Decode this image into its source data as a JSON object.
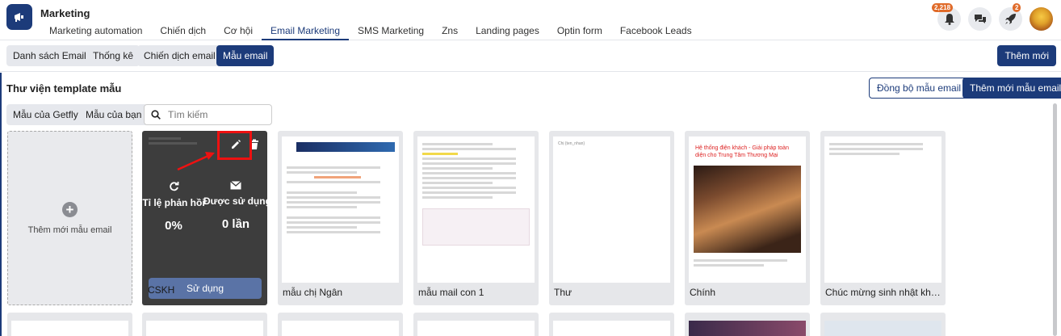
{
  "app": {
    "title": "Marketing"
  },
  "nav": {
    "items": [
      {
        "label": "Marketing automation",
        "active": false
      },
      {
        "label": "Chiến dịch",
        "active": false
      },
      {
        "label": "Cơ hội",
        "active": false
      },
      {
        "label": "Email Marketing",
        "active": true
      },
      {
        "label": "SMS Marketing",
        "active": false
      },
      {
        "label": "Zns",
        "active": false
      },
      {
        "label": "Landing pages",
        "active": false
      },
      {
        "label": "Optin form",
        "active": false
      },
      {
        "label": "Facebook Leads",
        "active": false
      }
    ]
  },
  "header_icons": {
    "notifications_badge": "2,218",
    "rocket_badge": "2",
    "icons": [
      "bell-icon",
      "chat-icon",
      "rocket-icon",
      "avatar"
    ]
  },
  "subnav": {
    "items": [
      "Danh sách Email",
      "Thống kê",
      "Chiến dịch email",
      "Mẫu email"
    ],
    "active": "Mẫu email",
    "add_button": "Thêm mới"
  },
  "library": {
    "title": "Thư viện template mẫu",
    "sync_button": "Đồng bộ mẫu email",
    "add_template_button": "Thêm mới mẫu email",
    "filters": [
      "Mẫu của Getfly",
      "Mẫu của bạn"
    ],
    "search_placeholder": "Tìm kiếm"
  },
  "add_card": {
    "label": "Thêm mới mẫu email"
  },
  "hover_card": {
    "name": "CSKH",
    "stats": [
      {
        "label": "Tỉ lệ phản hồi",
        "value": "0%",
        "icon": "refresh-icon"
      },
      {
        "label": "Được sử dụng",
        "value": "0 lần",
        "icon": "envelope-icon"
      }
    ],
    "use_button": "Sử dụng"
  },
  "templates": [
    {
      "name": "mẫu chị Ngân"
    },
    {
      "name": "mẫu mail con 1"
    },
    {
      "name": "Thư",
      "thumb_text": "Chị {ten_nhan}"
    },
    {
      "name": "Chính",
      "thumb_title": "Hệ thống điện khách - Giải pháp toàn diện cho Trung Tâm Thương Mại"
    },
    {
      "name": "Chúc mừng sinh nhật khách ..."
    }
  ],
  "colors": {
    "brand": "#1c3b7a",
    "badge": "#e06b2a",
    "highlight": "#e11111"
  }
}
